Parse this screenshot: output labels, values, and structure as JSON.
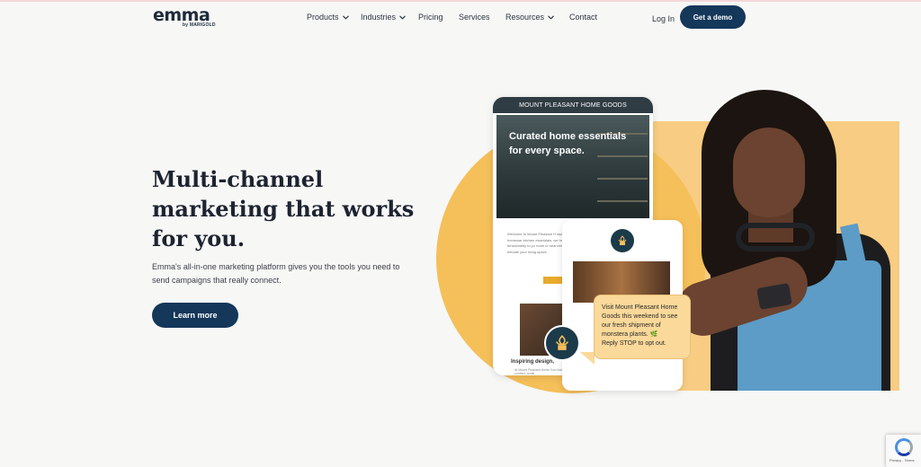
{
  "brand": {
    "logo_text": "emma",
    "logo_sub": "by MARIGOLD"
  },
  "nav": {
    "items": [
      {
        "label": "Products",
        "has_dropdown": true
      },
      {
        "label": "Industries",
        "has_dropdown": true
      },
      {
        "label": "Pricing",
        "has_dropdown": false
      },
      {
        "label": "Services",
        "has_dropdown": false
      },
      {
        "label": "Resources",
        "has_dropdown": true
      },
      {
        "label": "Contact",
        "has_dropdown": false
      }
    ],
    "login_label": "Log In",
    "demo_label": "Get a demo"
  },
  "hero": {
    "title_lines": [
      "Multi-channel",
      "marketing that works",
      "for you."
    ],
    "subtitle_lines": [
      "Emma's all-in-one marketing platform gives you the tools you need to",
      "send campaigns that really connect."
    ],
    "cta_label": "Learn more"
  },
  "illustration": {
    "phone_header": "MOUNT PLEASANT HOME GOODS",
    "phone_hero_lines": [
      "Curated home essentials",
      "for every space."
    ],
    "phone_body": "Welcome to Mount Pleasant H stylish, high-quality homewar kitchen essentials, we handpi beauty and functionality to yo room or searching for the per to elevate your living space.",
    "phone_inspire": "Inspiring design,",
    "phone_body2": "At Mount Pleasant Home Goo fosters comfort, creati",
    "bubble_lines": [
      "Visit Mount Pleasant Home",
      "Goods this weekend to see",
      "our fresh shipment of",
      "monstera plants. 🌿",
      "Reply STOP to opt out."
    ]
  },
  "recaptcha": {
    "text": "Privacy - Terms"
  },
  "colors": {
    "primary": "#14375a",
    "accent_yellow": "#f5bf59",
    "panel_yellow": "#f8cc82",
    "background": "#f7f7f6"
  }
}
